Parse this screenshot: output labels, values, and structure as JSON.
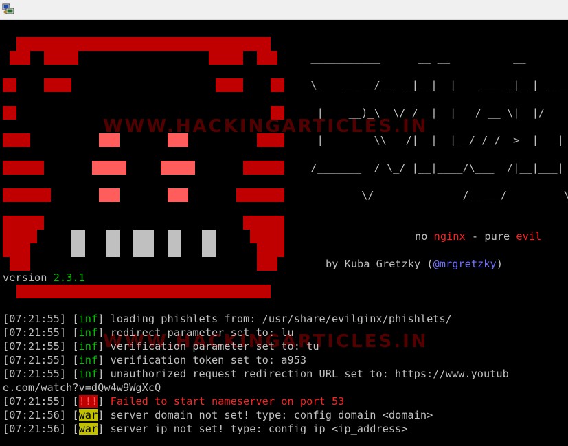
{
  "window": {
    "icon": "terminal-app-icon"
  },
  "banner": {
    "ascii_lines": [
      "  ___________      __ __          __",
      "  \\_   _____/__  _|__|  |    ____ |__| ____ ___  ___",
      "   |    __)_\\  \\/ /  |  |   / __ \\|  |/    \\\\  \\/  /",
      "   |        \\\\   /|  |  |__/ /_/  >  |   |  \\>    <",
      "  /_______  / \\_/ |__|____/\\___  /|__|___|  /__/\\_ \\",
      "          \\/              /_____/         \\/      \\/"
    ],
    "tagline": {
      "no": "no",
      "nginx": "nginx",
      "dash": "-",
      "pure": "pure",
      "evil": "evil"
    },
    "author": {
      "by": "by Kuba Gretzky",
      "open": "(",
      "handle": "@mrgretzky",
      "close": ")"
    },
    "version": {
      "label": "version",
      "number": "2.3.1"
    },
    "watermark": "WWW.HACKINGARTICLES.IN"
  },
  "log": [
    {
      "time": "[07:21:55]",
      "open": "[",
      "tag": "inf",
      "close": "]",
      "message": "loading phishlets from: /usr/share/evilginx/phishlets/"
    },
    {
      "time": "[07:21:55]",
      "open": "[",
      "tag": "inf",
      "close": "]",
      "message": "redirect parameter set to: lu"
    },
    {
      "time": "[07:21:55]",
      "open": "[",
      "tag": "inf",
      "close": "]",
      "message": "verification parameter set to: tu"
    },
    {
      "time": "[07:21:55]",
      "open": "[",
      "tag": "inf",
      "close": "]",
      "message": "verification token set to: a953"
    },
    {
      "time": "[07:21:55]",
      "open": "[",
      "tag": "inf",
      "close": "]",
      "message": "unauthorized request redirection URL set to: https://www.youtub"
    },
    {
      "continuation": "e.com/watch?v=dQw4w9WgXcQ"
    },
    {
      "time": "[07:21:55]",
      "open": "[",
      "tag": "!!!",
      "close": "]",
      "message": "Failed to start nameserver on port 53"
    },
    {
      "time": "[07:21:56]",
      "open": "[",
      "tag": "war",
      "close": "]",
      "message": "server domain not set! type: config domain <domain>"
    },
    {
      "time": "[07:21:56]",
      "open": "[",
      "tag": "war",
      "close": "]",
      "message": "server ip not set! type: config ip <ip_address>"
    }
  ],
  "colors": {
    "logo_red": "#c00000",
    "logo_pink": "#ff5c5c",
    "teeth_grey": "#c0c0c0",
    "inf_green": "#00c000",
    "handle_blue": "#6f6fff",
    "war_yellow": "#c0c000"
  }
}
